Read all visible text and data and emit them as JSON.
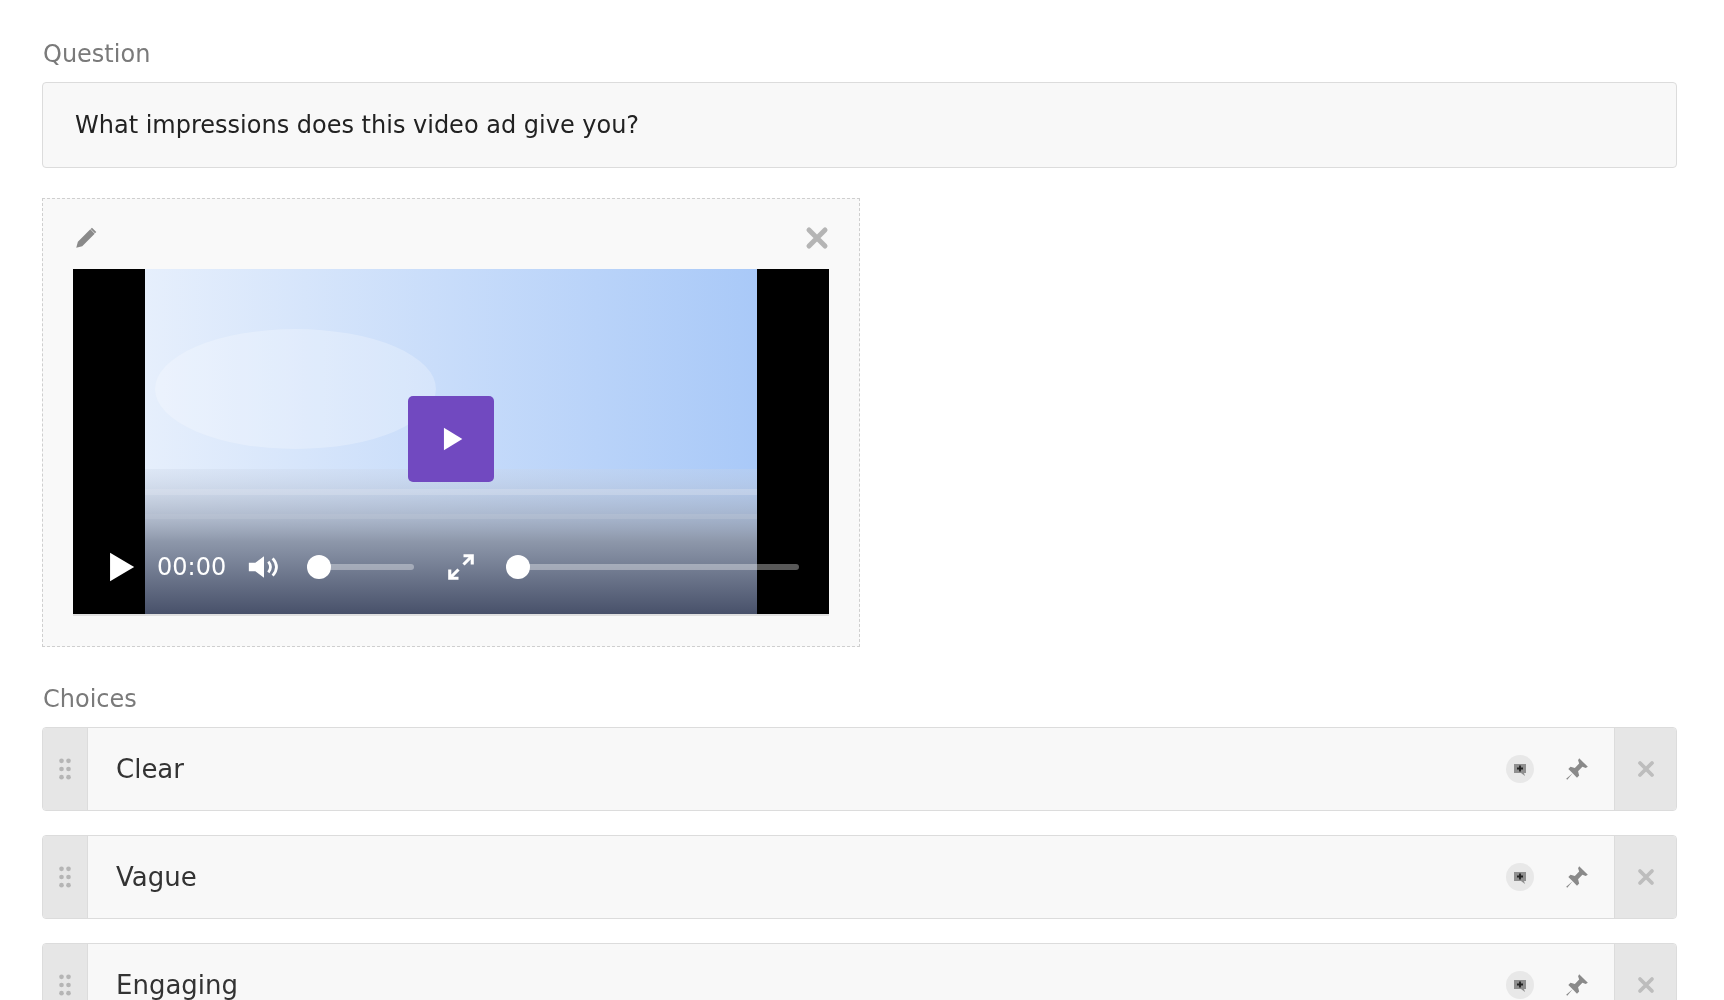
{
  "question": {
    "label": "Question",
    "value": "What impressions does this video ad give you?"
  },
  "media": {
    "kind": "picture",
    "player": {
      "time": "00:00",
      "volume": {
        "level": 0.04
      },
      "progress": {
        "level": 0
      }
    }
  },
  "choices_label": "Choices",
  "choices": [
    {
      "text": "Clear"
    },
    {
      "text": "Vague"
    },
    {
      "text": "Engaging"
    }
  ]
}
